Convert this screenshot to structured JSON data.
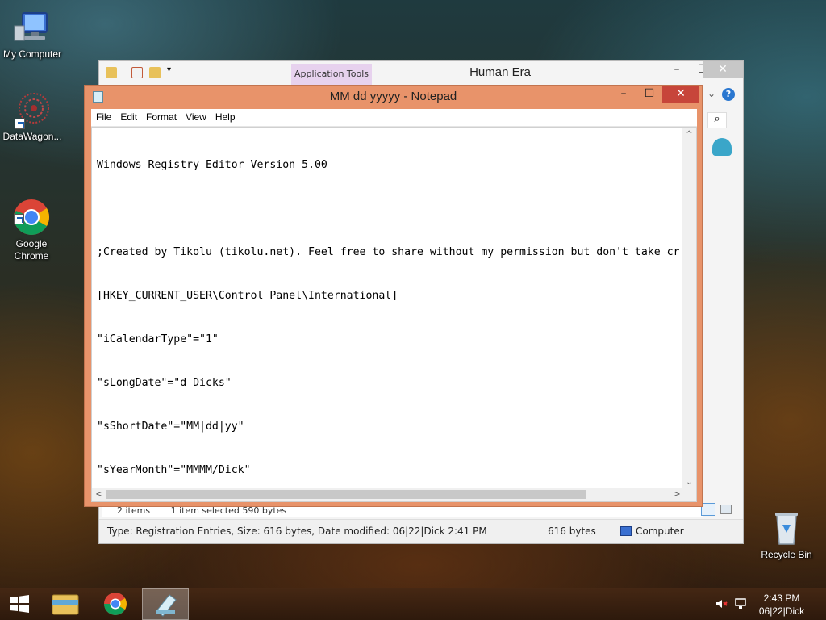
{
  "desktop": {
    "icons": [
      {
        "label": "My Computer"
      },
      {
        "label": "DataWagon..."
      },
      {
        "label": "Google\nChrome"
      },
      {
        "label": "Recycle Bin"
      }
    ]
  },
  "explorer": {
    "title": "Human Era",
    "application_tools_label": "Application Tools",
    "status_items": "2 items",
    "status_selected": "1 item selected  590 bytes",
    "details_text": "Type: Registration Entries, Size: 616 bytes, Date modified: 06|22|Dick 2:41 PM",
    "details_size": "616 bytes",
    "details_location": "Computer"
  },
  "notepad": {
    "title": "MM dd yyyyy - Notepad",
    "menu": [
      "File",
      "Edit",
      "Format",
      "View",
      "Help"
    ],
    "lines": [
      "Windows Registry Editor Version 5.00",
      "",
      ";Created by Tikolu (tikolu.net). Feel free to share without my permission but don't take cr",
      "[HKEY_CURRENT_USER\\Control Panel\\International]",
      "\"iCalendarType\"=\"1\"",
      "\"sLongDate\"=\"d Dicks\"",
      "\"sShortDate\"=\"MM|dd|yy\"",
      "\"sYearMonth\"=\"MMMM/Dick\""
    ]
  },
  "taskbar": {
    "time": "2:43 PM",
    "date": "06|22|Dick"
  },
  "colors": {
    "notepad_frame": "#e8936a",
    "close_button": "#c7453a",
    "application_tools": "#e7d2ee"
  }
}
